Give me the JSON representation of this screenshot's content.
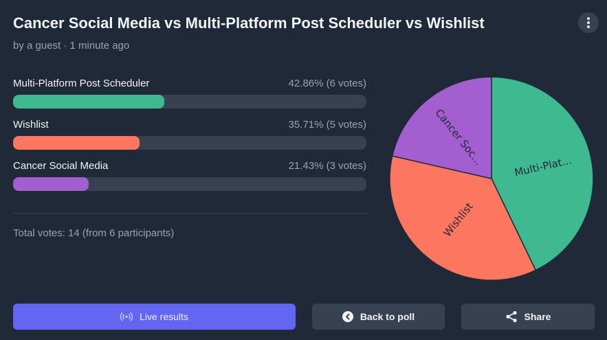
{
  "poll": {
    "title": "Cancer Social Media vs Multi-Platform Post Scheduler vs Wishlist",
    "byline": "by a guest · 1 minute ago"
  },
  "results": [
    {
      "label": "Multi-Platform Post Scheduler",
      "value_text": "42.86% (6 votes)",
      "percent": 42.86,
      "color": "#3fb98f"
    },
    {
      "label": "Wishlist",
      "value_text": "35.71% (5 votes)",
      "percent": 35.71,
      "color": "#fd765f"
    },
    {
      "label": "Cancer Social Media",
      "value_text": "21.43% (3 votes)",
      "percent": 21.43,
      "color": "#a35fcf"
    }
  ],
  "total": {
    "label": "Total votes:",
    "votes": "14",
    "participants": "(from 6 participants)"
  },
  "buttons": {
    "live": "Live results",
    "back": "Back to poll",
    "share": "Share"
  },
  "icons": {
    "menu": "vertical-dots-icon",
    "live": "broadcast-icon",
    "back": "arrow-left-circle-icon",
    "share": "share-icon"
  },
  "chart_data": {
    "type": "pie",
    "categories": [
      "Multi-Platform Post Scheduler",
      "Wishlist",
      "Cancer Social Media"
    ],
    "slice_labels": [
      "Multi-Plat...",
      "Wishlist",
      "Cancer Soc..."
    ],
    "values": [
      6,
      5,
      3
    ],
    "colors": [
      "#3fb98f",
      "#fd765f",
      "#a35fcf"
    ]
  }
}
